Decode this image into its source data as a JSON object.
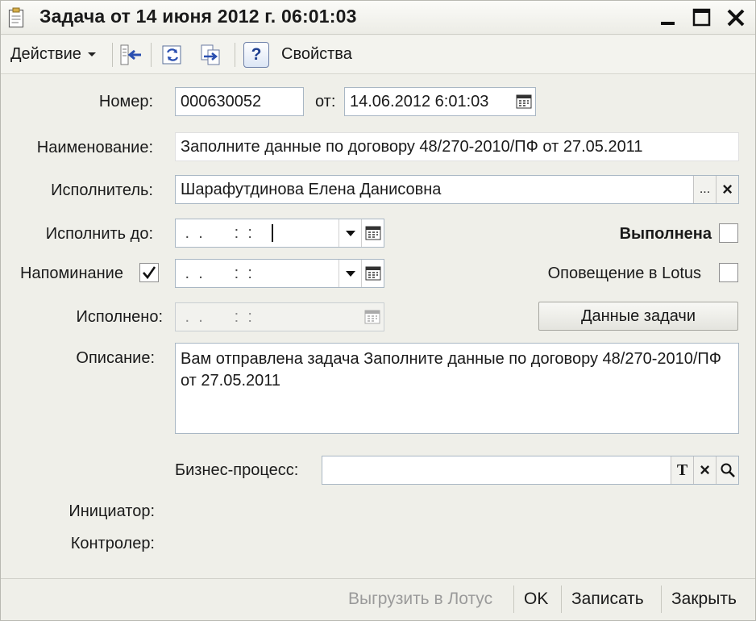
{
  "window": {
    "title": "Задача от 14 июня 2012 г. 06:01:03"
  },
  "toolbar": {
    "action_label": "Действие",
    "properties_label": "Свойства",
    "help_symbol": "?"
  },
  "form": {
    "number_label": "Номер:",
    "number_value": "000630052",
    "date_label": "от:",
    "date_value": "14.06.2012  6:01:03",
    "name_label": "Наименование:",
    "name_value": "Заполните данные по договору 48/270-2010/ПФ от 27.05.2011",
    "executor_label": "Исполнитель:",
    "executor_value": "Шарафутдинова Елена Данисовна",
    "executor_select_symbol": "...",
    "executor_clear_symbol": "×",
    "due_label": "Исполнить до:",
    "due_value": " .  .       :  :",
    "completed_label": "Выполнена",
    "completed_checked": false,
    "reminder_label": "Напоминание",
    "reminder_checked": true,
    "reminder_value": " .  .       :  :",
    "lotus_label": "Оповещение в Lotus",
    "lotus_checked": false,
    "done_label": "Исполнено:",
    "done_value": " .  .       :  :",
    "task_data_button": "Данные задачи",
    "description_label": "Описание:",
    "description_value": "Вам отправлена задача Заполните данные по договору 48/270-2010/ПФ от 27.05.2011",
    "process_label": "Бизнес-процесс:",
    "process_value": "",
    "process_type_symbol": "T",
    "process_clear_symbol": "×",
    "initiator_label": "Инициатор:",
    "controller_label": "Контролер:"
  },
  "footer": {
    "export_lotus": "Выгрузить в Лотус",
    "ok": "OK",
    "save": "Записать",
    "close": "Закрыть"
  },
  "colors": {
    "field_border": "#a9b7c4",
    "window_bg": "#efefe9",
    "accent_blue": "#2a4fb0"
  }
}
